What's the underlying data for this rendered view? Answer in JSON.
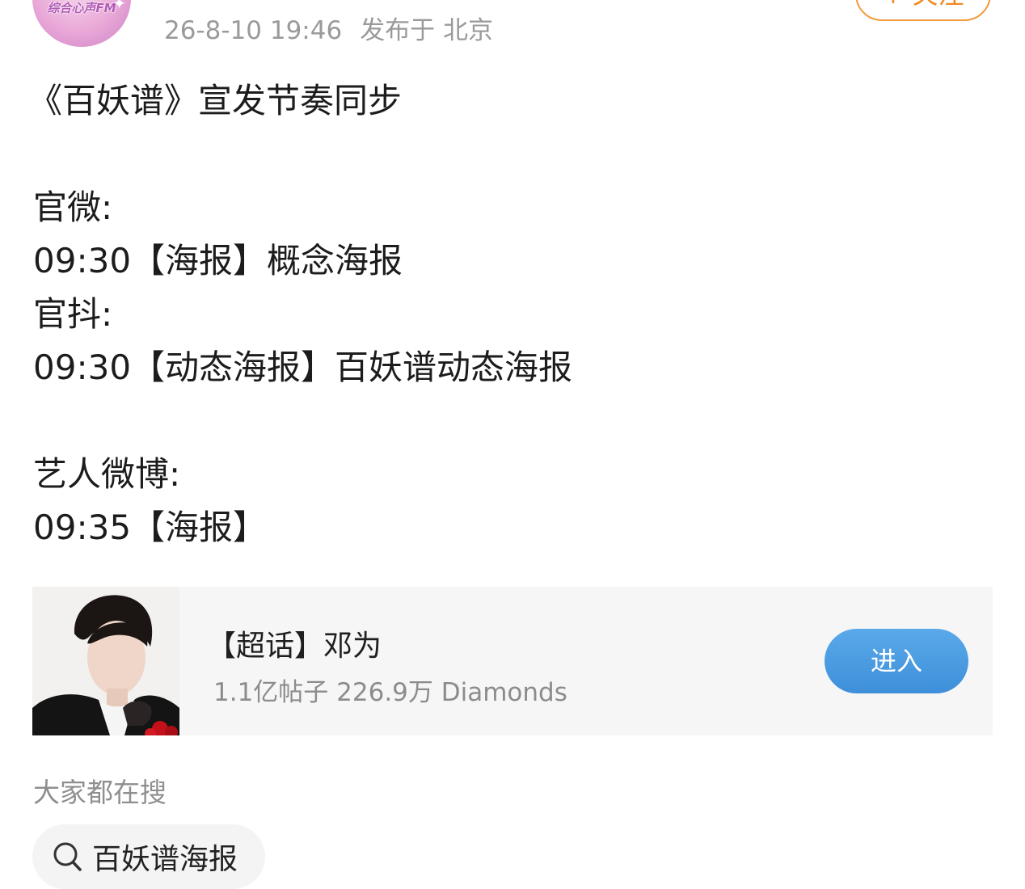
{
  "header": {
    "avatar_caption": "综合心声FM",
    "post_time": "26-8-10 19:46",
    "post_location": "发布于 北京",
    "follow_label": "+ 关注"
  },
  "post": {
    "lines": [
      "《百妖谱》宣发节奏同步",
      "",
      "官微:",
      "09:30【海报】概念海报",
      "官抖:",
      "09:30【动态海报】百妖谱动态海报",
      "",
      "艺人微博:",
      "09:35【海报】"
    ]
  },
  "topic_card": {
    "name": "【超话】邓为",
    "stats": "1.1亿帖子 226.9万 Diamonds",
    "enter_label": "进入",
    "thumb_icon": "celebrity-portrait",
    "enter_color": "#4a9be0"
  },
  "search": {
    "section_title": "大家都在搜",
    "chips": [
      {
        "label": "百妖谱海报",
        "icon": "search-icon"
      }
    ]
  },
  "colors": {
    "meta_text": "#9a9a9a",
    "follow_accent": "#f08a24",
    "card_background": "#f6f6f6"
  }
}
